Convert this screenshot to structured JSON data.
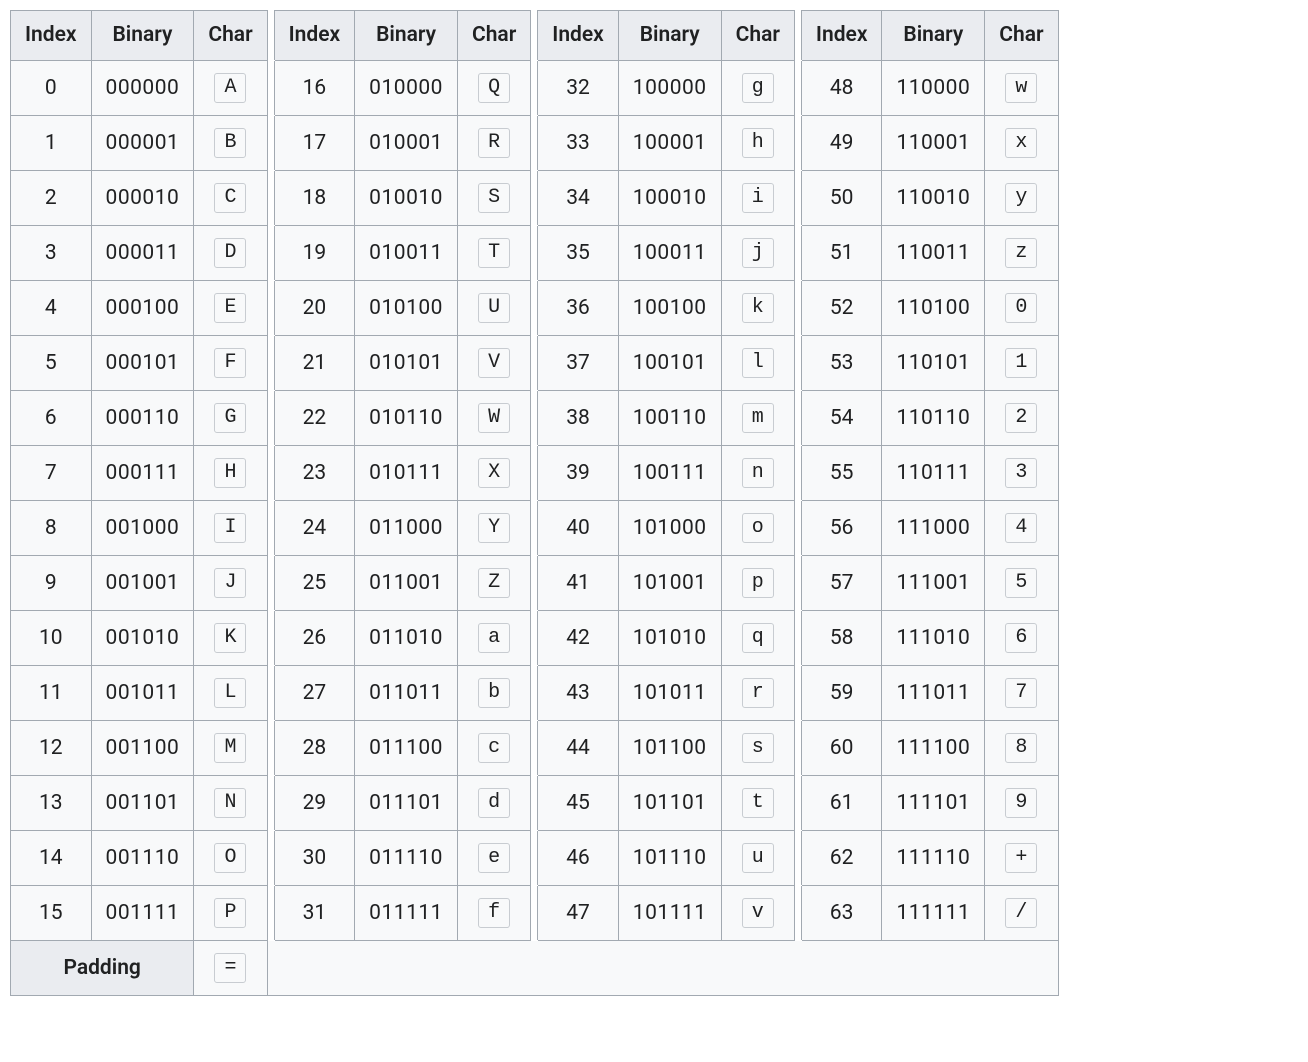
{
  "headers": {
    "index": "Index",
    "binary": "Binary",
    "char": "Char"
  },
  "padding": {
    "label": "Padding",
    "char": "="
  },
  "groups": [
    [
      {
        "index": 0,
        "binary": "000000",
        "char": "A"
      },
      {
        "index": 1,
        "binary": "000001",
        "char": "B"
      },
      {
        "index": 2,
        "binary": "000010",
        "char": "C"
      },
      {
        "index": 3,
        "binary": "000011",
        "char": "D"
      },
      {
        "index": 4,
        "binary": "000100",
        "char": "E"
      },
      {
        "index": 5,
        "binary": "000101",
        "char": "F"
      },
      {
        "index": 6,
        "binary": "000110",
        "char": "G"
      },
      {
        "index": 7,
        "binary": "000111",
        "char": "H"
      },
      {
        "index": 8,
        "binary": "001000",
        "char": "I"
      },
      {
        "index": 9,
        "binary": "001001",
        "char": "J"
      },
      {
        "index": 10,
        "binary": "001010",
        "char": "K"
      },
      {
        "index": 11,
        "binary": "001011",
        "char": "L"
      },
      {
        "index": 12,
        "binary": "001100",
        "char": "M"
      },
      {
        "index": 13,
        "binary": "001101",
        "char": "N"
      },
      {
        "index": 14,
        "binary": "001110",
        "char": "O"
      },
      {
        "index": 15,
        "binary": "001111",
        "char": "P"
      }
    ],
    [
      {
        "index": 16,
        "binary": "010000",
        "char": "Q"
      },
      {
        "index": 17,
        "binary": "010001",
        "char": "R"
      },
      {
        "index": 18,
        "binary": "010010",
        "char": "S"
      },
      {
        "index": 19,
        "binary": "010011",
        "char": "T"
      },
      {
        "index": 20,
        "binary": "010100",
        "char": "U"
      },
      {
        "index": 21,
        "binary": "010101",
        "char": "V"
      },
      {
        "index": 22,
        "binary": "010110",
        "char": "W"
      },
      {
        "index": 23,
        "binary": "010111",
        "char": "X"
      },
      {
        "index": 24,
        "binary": "011000",
        "char": "Y"
      },
      {
        "index": 25,
        "binary": "011001",
        "char": "Z"
      },
      {
        "index": 26,
        "binary": "011010",
        "char": "a"
      },
      {
        "index": 27,
        "binary": "011011",
        "char": "b"
      },
      {
        "index": 28,
        "binary": "011100",
        "char": "c"
      },
      {
        "index": 29,
        "binary": "011101",
        "char": "d"
      },
      {
        "index": 30,
        "binary": "011110",
        "char": "e"
      },
      {
        "index": 31,
        "binary": "011111",
        "char": "f"
      }
    ],
    [
      {
        "index": 32,
        "binary": "100000",
        "char": "g"
      },
      {
        "index": 33,
        "binary": "100001",
        "char": "h"
      },
      {
        "index": 34,
        "binary": "100010",
        "char": "i"
      },
      {
        "index": 35,
        "binary": "100011",
        "char": "j"
      },
      {
        "index": 36,
        "binary": "100100",
        "char": "k"
      },
      {
        "index": 37,
        "binary": "100101",
        "char": "l"
      },
      {
        "index": 38,
        "binary": "100110",
        "char": "m"
      },
      {
        "index": 39,
        "binary": "100111",
        "char": "n"
      },
      {
        "index": 40,
        "binary": "101000",
        "char": "o"
      },
      {
        "index": 41,
        "binary": "101001",
        "char": "p"
      },
      {
        "index": 42,
        "binary": "101010",
        "char": "q"
      },
      {
        "index": 43,
        "binary": "101011",
        "char": "r"
      },
      {
        "index": 44,
        "binary": "101100",
        "char": "s"
      },
      {
        "index": 45,
        "binary": "101101",
        "char": "t"
      },
      {
        "index": 46,
        "binary": "101110",
        "char": "u"
      },
      {
        "index": 47,
        "binary": "101111",
        "char": "v"
      }
    ],
    [
      {
        "index": 48,
        "binary": "110000",
        "char": "w"
      },
      {
        "index": 49,
        "binary": "110001",
        "char": "x"
      },
      {
        "index": 50,
        "binary": "110010",
        "char": "y"
      },
      {
        "index": 51,
        "binary": "110011",
        "char": "z"
      },
      {
        "index": 52,
        "binary": "110100",
        "char": "0"
      },
      {
        "index": 53,
        "binary": "110101",
        "char": "1"
      },
      {
        "index": 54,
        "binary": "110110",
        "char": "2"
      },
      {
        "index": 55,
        "binary": "110111",
        "char": "3"
      },
      {
        "index": 56,
        "binary": "111000",
        "char": "4"
      },
      {
        "index": 57,
        "binary": "111001",
        "char": "5"
      },
      {
        "index": 58,
        "binary": "111010",
        "char": "6"
      },
      {
        "index": 59,
        "binary": "111011",
        "char": "7"
      },
      {
        "index": 60,
        "binary": "111100",
        "char": "8"
      },
      {
        "index": 61,
        "binary": "111101",
        "char": "9"
      },
      {
        "index": 62,
        "binary": "111110",
        "char": "+"
      },
      {
        "index": 63,
        "binary": "111111",
        "char": "/"
      }
    ]
  ]
}
